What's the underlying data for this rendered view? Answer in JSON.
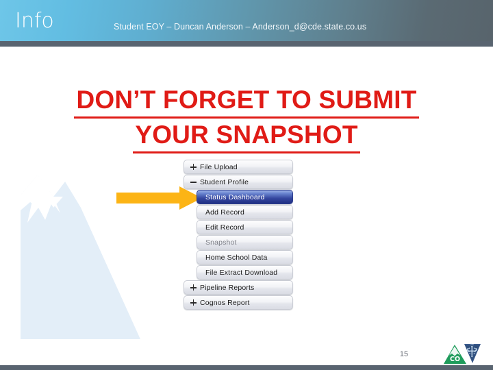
{
  "header": {
    "title": "Info",
    "subtitle": "Student EOY – Duncan Anderson – Anderson_d@cde.state.co.us"
  },
  "headline": {
    "line1": "DON’T FORGET TO SUBMIT",
    "line2": "YOUR SNAPSHOT",
    "color": "#e01b16"
  },
  "callout": {
    "arrow_icon": "right-arrow-icon",
    "color": "#fcb415",
    "points_to": "Status Dashboard"
  },
  "menu": {
    "items": [
      {
        "label": "File Upload",
        "level": "top",
        "toggle": "plus",
        "state": "collapsed"
      },
      {
        "label": "Student Profile",
        "level": "top",
        "toggle": "minus",
        "state": "expanded"
      },
      {
        "label": "Status Dashboard",
        "level": "sub",
        "toggle": "none",
        "state": "selected"
      },
      {
        "label": "Add Record",
        "level": "sub",
        "toggle": "none",
        "state": "normal"
      },
      {
        "label": "Edit Record",
        "level": "sub",
        "toggle": "none",
        "state": "normal"
      },
      {
        "label": "Snapshot",
        "level": "sub",
        "toggle": "none",
        "state": "disabled"
      },
      {
        "label": "Home School Data",
        "level": "sub",
        "toggle": "none",
        "state": "normal"
      },
      {
        "label": "File Extract Download",
        "level": "sub",
        "toggle": "none",
        "state": "normal"
      },
      {
        "label": "Pipeline Reports",
        "level": "top",
        "toggle": "plus",
        "state": "collapsed"
      },
      {
        "label": "Cognos Report",
        "level": "top",
        "toggle": "plus",
        "state": "collapsed"
      }
    ]
  },
  "footer": {
    "page_number": "15",
    "logo_text": "CO",
    "logo_icon": "colorado-mountain-snowflake-logo"
  },
  "decor": {
    "mountain_icon": "mountain-watermark-icon"
  }
}
